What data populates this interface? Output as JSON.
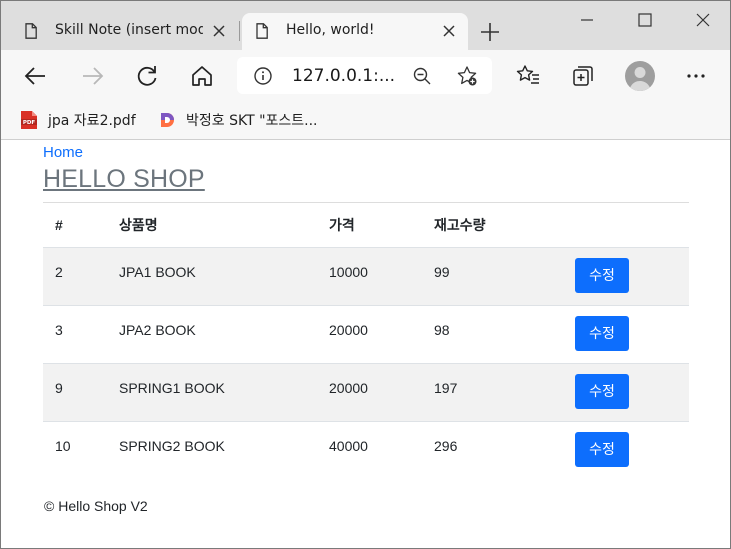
{
  "browser": {
    "tabs": [
      {
        "title": "Skill Note (insert mode",
        "active": false
      },
      {
        "title": "Hello, world!",
        "active": true
      }
    ],
    "address": "127.0.0.1:...",
    "bookmarks": [
      {
        "label": "jpa 자료2.pdf",
        "icon": "pdf-icon"
      },
      {
        "label": "박정호 SKT \"포스트...",
        "icon": "d-app-icon"
      }
    ]
  },
  "page": {
    "breadcrumb": "Home",
    "title": "HELLO SHOP",
    "table": {
      "headers": [
        "#",
        "상품명",
        "가격",
        "재고수량",
        ""
      ],
      "rows": [
        {
          "id": "2",
          "name": "JPA1 BOOK",
          "price": "10000",
          "stock": "99",
          "action": "수정"
        },
        {
          "id": "3",
          "name": "JPA2 BOOK",
          "price": "20000",
          "stock": "98",
          "action": "수정"
        },
        {
          "id": "9",
          "name": "SPRING1 BOOK",
          "price": "20000",
          "stock": "197",
          "action": "수정"
        },
        {
          "id": "10",
          "name": "SPRING2 BOOK",
          "price": "40000",
          "stock": "296",
          "action": "수정"
        }
      ]
    },
    "footer": "© Hello Shop V2"
  },
  "colors": {
    "primary": "#0d6efd",
    "title_gray": "#6c757d",
    "stripe": "#f2f2f2"
  }
}
